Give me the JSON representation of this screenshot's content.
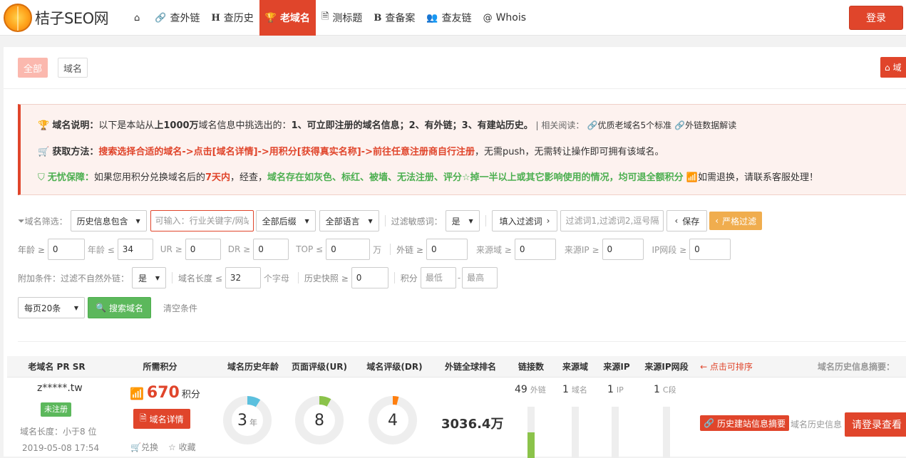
{
  "header": {
    "logo_text": "桔子SEO网",
    "nav": [
      {
        "icon": "home-icon",
        "glyph": "⌂",
        "label": ""
      },
      {
        "icon": "link-icon",
        "glyph": "🔗",
        "label": "查外链"
      },
      {
        "icon": "history-h-icon",
        "glyph": "H",
        "label": "查历史"
      },
      {
        "icon": "trophy-icon",
        "glyph": "🏆",
        "label": "老域名",
        "active": true
      },
      {
        "icon": "document-icon",
        "glyph": "🗎",
        "label": "测标题"
      },
      {
        "icon": "beian-b-icon",
        "glyph": "B",
        "label": "查备案"
      },
      {
        "icon": "friends-icon",
        "glyph": "👥",
        "label": "查友链"
      },
      {
        "icon": "at-icon",
        "glyph": "@",
        "label": "Whois"
      }
    ],
    "login_label": "登录"
  },
  "tabs": {
    "all": "全部",
    "domain": "域名",
    "home_mini": "域"
  },
  "notice": {
    "line1": {
      "title": "域名说明：",
      "text_a": "以下是本站从",
      "bold_a": "上1000万",
      "text_b": "域名信息中挑选出的：",
      "bold_b": "1、可立即注册的域名信息；2、有外链；3、有建站历史。",
      "related": " | 相关阅读：",
      "link1": "优质老域名5个标准",
      "link2": "外链数据解读"
    },
    "line2": {
      "title": "获取方法：",
      "bold": "搜索选择合适的域名->点击[域名详情]->用积分[获得真实名称]->前往任意注册商自行注册",
      "text": "，无需push，无需转让操作即可拥有该域名。"
    },
    "line3": {
      "title": "无忧保障：",
      "text_a": "如果您用积分兑换域名后的",
      "days": "7天内",
      "text_b": "，经查，",
      "green": "域名存在如灰色、标红、被墙、无法注册、评分☆掉一半以上或其它影响使用的情况，均可退全额积分",
      "text_c": "如需退换，请联系客服处理！"
    }
  },
  "filters": {
    "row1": {
      "label": "域名筛选：",
      "history_select": "历史信息包含",
      "keyword_placeholder": "可输入：行业关键字/网站",
      "suffix_select": "全部后缀",
      "lang_select": "全部语言",
      "sensitive_label": "过滤敏感词：",
      "sensitive_select": "是",
      "fill_btn": "填入过滤词",
      "filter_words_placeholder": "过滤词1,过滤词2,逗号隔开",
      "save_btn": "保存",
      "strict_btn": "严格过滤"
    },
    "row2": {
      "age_min_label": "年龄 ≥",
      "age_min": "0",
      "age_max_label": "年龄 ≤",
      "age_max": "34",
      "ur_label": "UR ≥",
      "ur": "0",
      "dr_label": "DR ≥",
      "dr": "0",
      "top_label": "TOP ≤",
      "top": "0",
      "top_unit": "万",
      "wl_label": "外链 ≥",
      "wl": "0",
      "ly_label": "来源域 ≥",
      "ly": "0",
      "ip_label": "来源IP ≥",
      "ip": "0",
      "ipseg_label": "IP网段 ≥",
      "ipseg": "0"
    },
    "row3": {
      "label": "附加条件：",
      "natural_label": "过滤不自然外链：",
      "natural_select": "是",
      "len_label": "域名长度 ≤",
      "len": "32",
      "len_unit": "个字母",
      "snap_label": "历史快照 ≥",
      "snap": "0",
      "score_label": "积分",
      "score_min_placeholder": "最低",
      "score_dash": "-",
      "score_max_placeholder": "最高"
    },
    "row4": {
      "per_page": "每页20条",
      "search_btn": "搜索域名",
      "clear": "清空条件"
    }
  },
  "table": {
    "headers": [
      "老域名 PR SR",
      "所需积分",
      "域名历史年龄",
      "页面评级(UR)",
      "域名评级(DR)",
      "外链全球排名",
      "链接数",
      "来源域",
      "来源IP",
      "来源IP网段",
      "← 点击可排序",
      "域名历史信息摘要："
    ],
    "rows": [
      {
        "domain": "z*****.tw",
        "status": "未注册",
        "length": "域名长度：小于8 位",
        "date": "2019-05-08 17:54",
        "score": "670",
        "score_unit": "积分",
        "detail_btn": "域名详情",
        "exchange": "兑换",
        "favorite": "收藏",
        "age": "3",
        "age_unit": "年",
        "age_fraction": 0.09,
        "ur": "8",
        "ur_fraction": 0.08,
        "dr": "4",
        "dr_fraction": 0.04,
        "rank": "3036.4万",
        "links": "49",
        "links_unit": "外链",
        "links_fill": 0.5,
        "ref_domains": "1",
        "ref_domains_unit": "域名",
        "ref_domains_fill": 0,
        "ref_ip": "1",
        "ref_ip_unit": "IP",
        "ref_ip_fill": 0,
        "ref_seg": "1",
        "ref_seg_unit": "C段",
        "ref_seg_fill": 0,
        "history_btn": "历史建站信息摘要",
        "history_text": "域名历史信息",
        "login_view": "请登录查看"
      }
    ]
  },
  "colors": {
    "accent": "#e0452b",
    "green": "#5cb85c",
    "ring_age": "#5bc0de",
    "ring_ur": "#8bc34a",
    "ring_dr": "#ff7f0e"
  }
}
